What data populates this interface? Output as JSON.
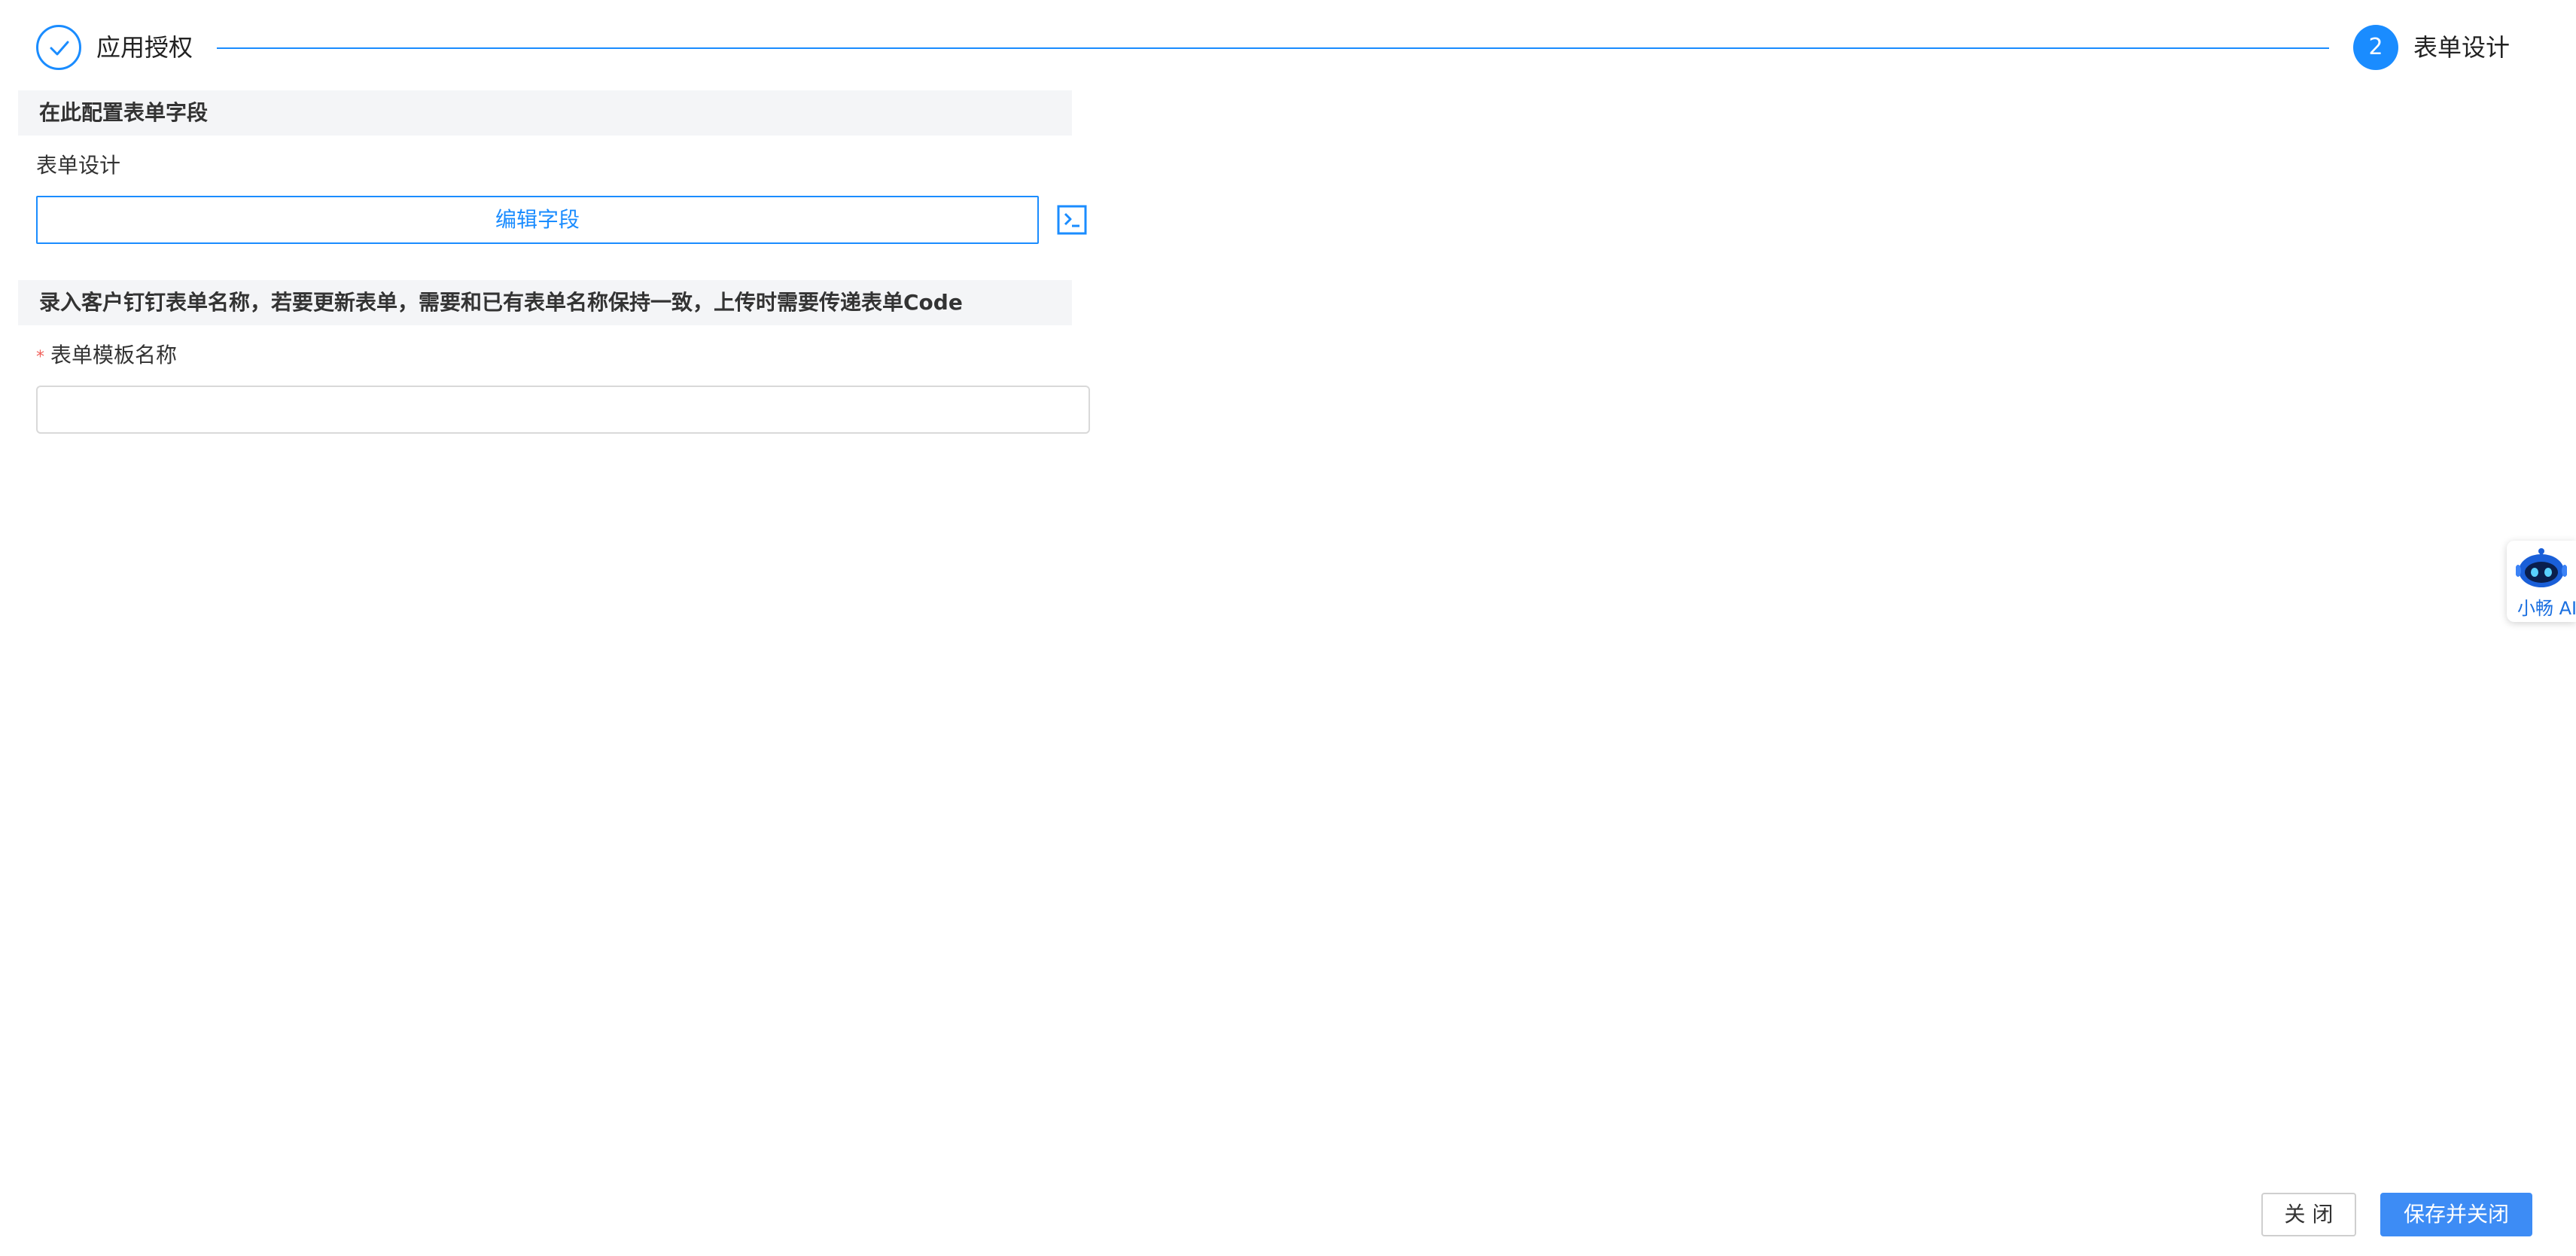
{
  "steps": [
    {
      "label": "应用授权",
      "status": "done"
    },
    {
      "label": "表单设计",
      "status": "current",
      "number": "2"
    }
  ],
  "section1": {
    "header": "在此配置表单字段",
    "field_label": "表单设计",
    "edit_button_label": "编辑字段",
    "terminal_icon": "terminal-icon"
  },
  "section2": {
    "header": "录入客户钉钉表单名称，若要更新表单，需要和已有表单名称保持一致，上传时需要传递表单Code",
    "required_mark": "*",
    "field_label": "表单模板名称",
    "input_value": "",
    "input_placeholder": ""
  },
  "ai_assistant": {
    "label": "小畅 AI",
    "icon": "robot-icon"
  },
  "footer": {
    "close_label": "关 闭",
    "save_close_label": "保存并关闭"
  },
  "colors": {
    "accent": "#1a8cff",
    "primary_button": "#3d8cf5",
    "required": "#f0605a",
    "section_bg": "#f4f5f7"
  }
}
